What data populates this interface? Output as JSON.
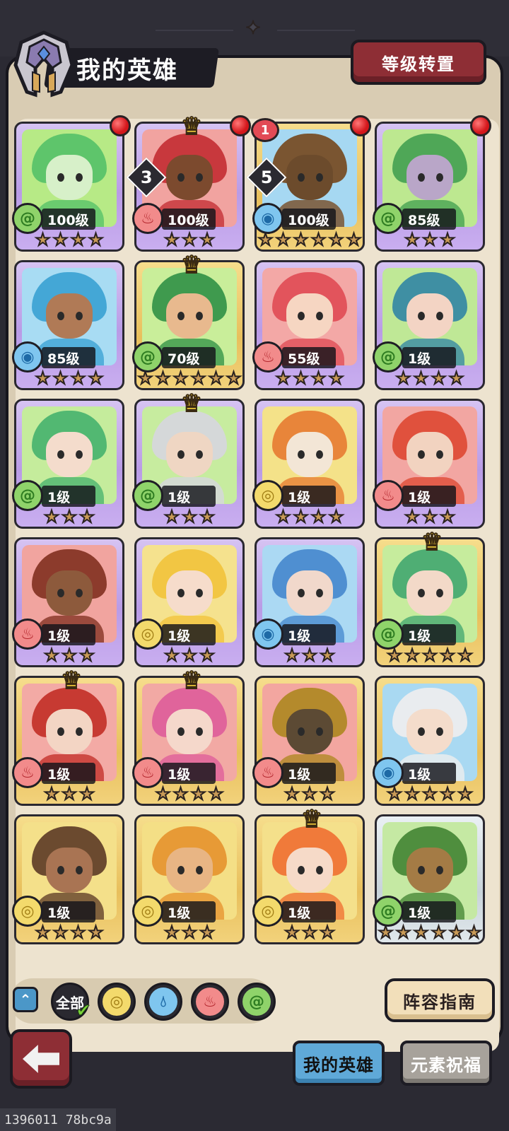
{
  "header": {
    "title": "我的英雄",
    "reset_button": "等级转置"
  },
  "heroes": [
    {
      "level": "100级",
      "element": "wind",
      "stars": 4,
      "card": "purple",
      "crown": false,
      "dot": true,
      "hair": "#5ec56b",
      "skin": "#d7f0c9",
      "bg": "#b7ea86",
      "rank": null
    },
    {
      "level": "100级",
      "element": "fire",
      "stars": 3,
      "card": "purple",
      "crown": true,
      "dot": true,
      "hair": "#c8383d",
      "skin": "#7c4a2e",
      "bg": "#f1a3a0",
      "rank": "3"
    },
    {
      "level": "100级",
      "element": "water",
      "stars": 6,
      "card": "gold",
      "crown": false,
      "dot": true,
      "hair": "#7a5531",
      "skin": "#6c4b2c",
      "bg": "#a6d8f2",
      "rank": "5",
      "badge": "1"
    },
    {
      "level": "85级",
      "element": "wind",
      "stars": 3,
      "card": "purple",
      "crown": false,
      "dot": true,
      "hair": "#4fa757",
      "skin": "#b9a6c8",
      "bg": "#bde890",
      "rank": null
    },
    {
      "level": "85级",
      "element": "water",
      "stars": 4,
      "card": "purple",
      "crown": false,
      "dot": false,
      "hair": "#44a7d6",
      "skin": "#b07a56",
      "bg": "#a8dcf3",
      "rank": null
    },
    {
      "level": "70级",
      "element": "wind",
      "stars": 6,
      "card": "gold",
      "crown": true,
      "dot": false,
      "hair": "#3f9a4e",
      "skin": "#e8b98e",
      "bg": "#c9ee9a",
      "rank": null
    },
    {
      "level": "55级",
      "element": "fire",
      "stars": 4,
      "card": "purple",
      "crown": false,
      "dot": false,
      "hair": "#e2545c",
      "skin": "#f6d6c2",
      "bg": "#f3a8a6",
      "rank": null
    },
    {
      "level": "1级",
      "element": "wind",
      "stars": 4,
      "card": "purple",
      "crown": false,
      "dot": false,
      "hair": "#3f8fa3",
      "skin": "#f3d4c4",
      "bg": "#bfe896",
      "rank": null
    },
    {
      "level": "1级",
      "element": "wind",
      "stars": 3,
      "card": "purple",
      "crown": false,
      "dot": false,
      "hair": "#52b872",
      "skin": "#f4dccc",
      "bg": "#c5ec9c",
      "rank": null
    },
    {
      "level": "1级",
      "element": "wind",
      "stars": 3,
      "card": "purple",
      "crown": true,
      "dot": false,
      "hair": "#d5d8d9",
      "skin": "#efd6c3",
      "bg": "#c7ec9f",
      "rank": null
    },
    {
      "level": "1级",
      "element": "earth",
      "stars": 4,
      "card": "purple",
      "crown": false,
      "dot": false,
      "hair": "#e8853a",
      "skin": "#f3e6d6",
      "bg": "#f4e289",
      "rank": null
    },
    {
      "level": "1级",
      "element": "fire",
      "stars": 3,
      "card": "purple",
      "crown": false,
      "dot": false,
      "hair": "#e0513d",
      "skin": "#f2d3c0",
      "bg": "#f2a6a2",
      "rank": null
    },
    {
      "level": "1级",
      "element": "fire",
      "stars": 3,
      "card": "purple",
      "crown": false,
      "dot": false,
      "hair": "#8c3b2c",
      "skin": "#8d5a3c",
      "bg": "#f1a49f",
      "rank": null
    },
    {
      "level": "1级",
      "element": "earth",
      "stars": 3,
      "card": "purple",
      "crown": false,
      "dot": false,
      "hair": "#f2c643",
      "skin": "#f6dccb",
      "bg": "#f5e28e",
      "rank": null
    },
    {
      "level": "1级",
      "element": "water",
      "stars": 3,
      "card": "purple",
      "crown": false,
      "dot": false,
      "hair": "#4f8fd1",
      "skin": "#f1d8cb",
      "bg": "#abd9f3",
      "rank": null
    },
    {
      "level": "1级",
      "element": "wind",
      "stars": 5,
      "card": "gold",
      "crown": true,
      "dot": false,
      "hair": "#4fae74",
      "skin": "#f3d9c8",
      "bg": "#c6ec9d",
      "rank": null
    },
    {
      "level": "1级",
      "element": "fire",
      "stars": 3,
      "card": "gold",
      "crown": true,
      "dot": false,
      "hair": "#c73a32",
      "skin": "#f3d5c4",
      "bg": "#f3aaa5",
      "rank": null
    },
    {
      "level": "1级",
      "element": "fire",
      "stars": 4,
      "card": "gold",
      "crown": true,
      "dot": false,
      "hair": "#e0649b",
      "skin": "#f5d8cb",
      "bg": "#f2a9a4",
      "rank": null
    },
    {
      "level": "1级",
      "element": "fire",
      "stars": 3,
      "card": "gold",
      "crown": false,
      "dot": false,
      "hair": "#b48a2c",
      "skin": "#5c4a34",
      "bg": "#f3a6a0",
      "rank": null
    },
    {
      "level": "1级",
      "element": "water",
      "stars": 5,
      "card": "gold",
      "crown": false,
      "dot": false,
      "hair": "#e9ecef",
      "skin": "#f4dccb",
      "bg": "#a9d9f2",
      "rank": null
    },
    {
      "level": "1级",
      "element": "earth",
      "stars": 4,
      "card": "gold",
      "crown": false,
      "dot": false,
      "hair": "#6b4a2f",
      "skin": "#a97453",
      "bg": "#f4e08a",
      "rank": null
    },
    {
      "level": "1级",
      "element": "earth",
      "stars": 3,
      "card": "gold",
      "crown": false,
      "dot": false,
      "hair": "#e79a36",
      "skin": "#e8b584",
      "bg": "#f4df86",
      "rank": null
    },
    {
      "level": "1级",
      "element": "earth",
      "stars": 3,
      "card": "gold",
      "crown": true,
      "dot": false,
      "hair": "#f07a3a",
      "skin": "#f6dac8",
      "bg": "#f4e08b",
      "rank": null
    },
    {
      "level": "1级",
      "element": "wind",
      "stars": 6,
      "card": "silver",
      "crown": false,
      "dot": false,
      "hair": "#4f8e3e",
      "skin": "#a47b45",
      "bg": "#c5e9a3",
      "rank": null
    }
  ],
  "filters": {
    "all_label": "全部",
    "elements": [
      "earth",
      "water",
      "fire",
      "wind"
    ],
    "colors": {
      "earth": "#f3da6c",
      "water": "#7fc6ef",
      "fire": "#f28b8b",
      "wind": "#8fd36a"
    }
  },
  "guide_button": "阵容指南",
  "tabs": {
    "my_heroes": "我的英雄",
    "element_blessing": "元素祝福"
  },
  "footer_id": "1396011 78bc9a"
}
